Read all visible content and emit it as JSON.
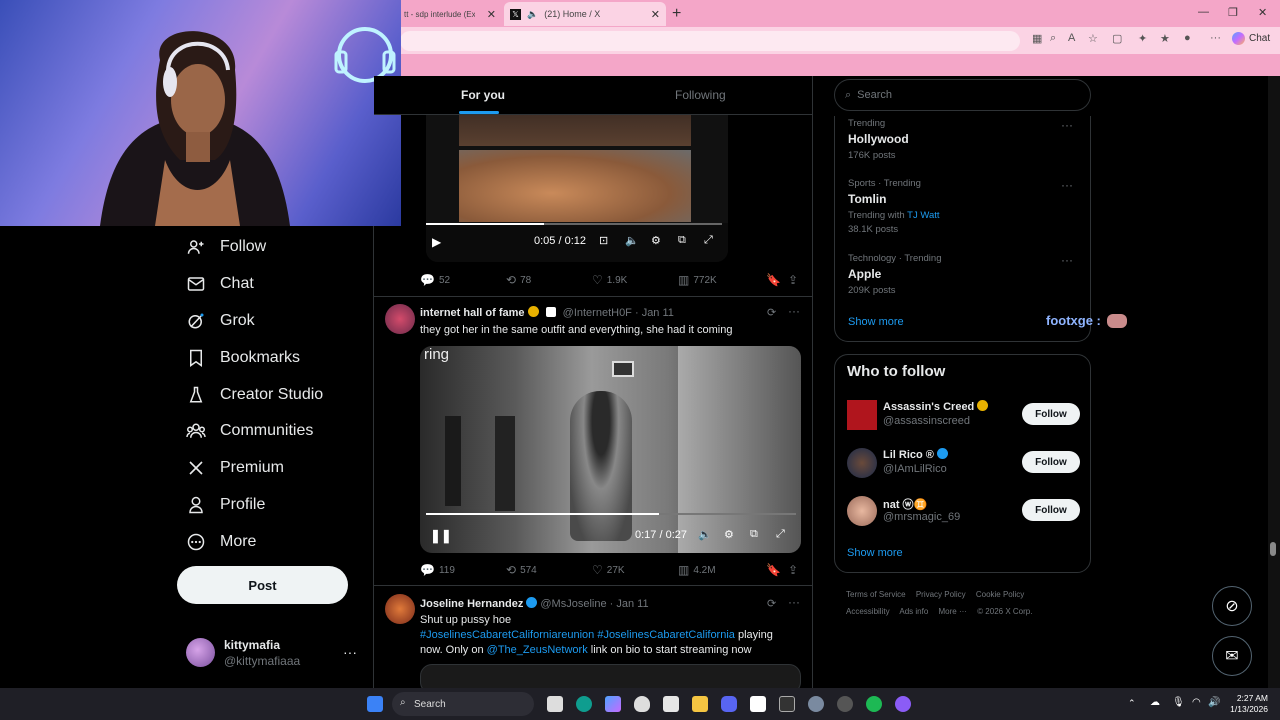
{
  "browser": {
    "tabs": [
      {
        "title": "tt - sdp interlude (Extend",
        "active": false
      },
      {
        "title": "(21) Home / X",
        "active": true
      }
    ],
    "chat_label": "Chat"
  },
  "nav": {
    "items": [
      {
        "label": "Follow",
        "icon": "follow-icon"
      },
      {
        "label": "Chat",
        "icon": "mail-icon"
      },
      {
        "label": "Grok",
        "icon": "grok-icon"
      },
      {
        "label": "Bookmarks",
        "icon": "bookmark-icon"
      },
      {
        "label": "Creator Studio",
        "icon": "creator-icon"
      },
      {
        "label": "Communities",
        "icon": "communities-icon"
      },
      {
        "label": "Premium",
        "icon": "x-icon"
      },
      {
        "label": "Profile",
        "icon": "profile-icon"
      },
      {
        "label": "More",
        "icon": "more-icon"
      }
    ],
    "post_label": "Post",
    "account": {
      "name": "kittymafia",
      "handle": "@kittymafiaaa"
    }
  },
  "timeline": {
    "tabs": {
      "for_you": "For you",
      "following": "Following"
    },
    "video1": {
      "time": "0:05 / 0:12",
      "progress": 0.4
    },
    "tweet1_actions": {
      "replies": "52",
      "reposts": "78",
      "likes": "1.9K",
      "views": "772K"
    },
    "tweet2": {
      "name": "internet hall of fame",
      "handle": "@InternetH0F",
      "date": "· Jan 11",
      "text": "they got her in the same outfit and everything, she had it coming",
      "video_watermark": "ring",
      "video_time": "0:17 / 0:27",
      "progress": 0.63,
      "actions": {
        "replies": "119",
        "reposts": "574",
        "likes": "27K",
        "views": "4.2M"
      }
    },
    "tweet3": {
      "name": "Joseline Hernandez",
      "handle": "@MsJoseline",
      "date": "· Jan 11",
      "line1": "Shut up pussy hoe",
      "hashtags": "#JoselinesCabaretCaliforniareunion #JoselinesCabaretCalifornia",
      "after_tags": " playing",
      "line3_pre": "now. Only on ",
      "mention": "@The_ZeusNetwork",
      "line3_post": " link on bio to start streaming now"
    }
  },
  "right": {
    "search_placeholder": "Search",
    "trends": [
      {
        "category": "Trending",
        "topic": "Hollywood",
        "posts": "176K posts",
        "with": ""
      },
      {
        "category": "Sports · Trending",
        "topic": "Tomlin",
        "posts": "38.1K posts",
        "with_prefix": "Trending with",
        "with": "TJ Watt"
      },
      {
        "category": "Technology · Trending",
        "topic": "Apple",
        "posts": "209K posts",
        "with": ""
      }
    ],
    "trends_show_more": "Show more",
    "who_to_follow": {
      "title": "Who to follow",
      "users": [
        {
          "name": "Assassin's Creed",
          "handle": "@assassinscreed",
          "button": "Follow"
        },
        {
          "name": "Lil Rico ®",
          "handle": "@IAmLilRico",
          "button": "Follow"
        },
        {
          "name": "nat ⓦ♊",
          "handle": "@mrsmagic_69",
          "button": "Follow"
        }
      ],
      "show_more": "Show more"
    },
    "footer": {
      "links": [
        "Terms of Service",
        "Privacy Policy",
        "Cookie Policy",
        "Accessibility",
        "Ads info",
        "More ···",
        "© 2026 X Corp."
      ]
    }
  },
  "overlay_chat": {
    "user": "footxge :"
  },
  "taskbar": {
    "search_label": "Search",
    "time": "2:27 AM",
    "date": "1/13/2026"
  }
}
